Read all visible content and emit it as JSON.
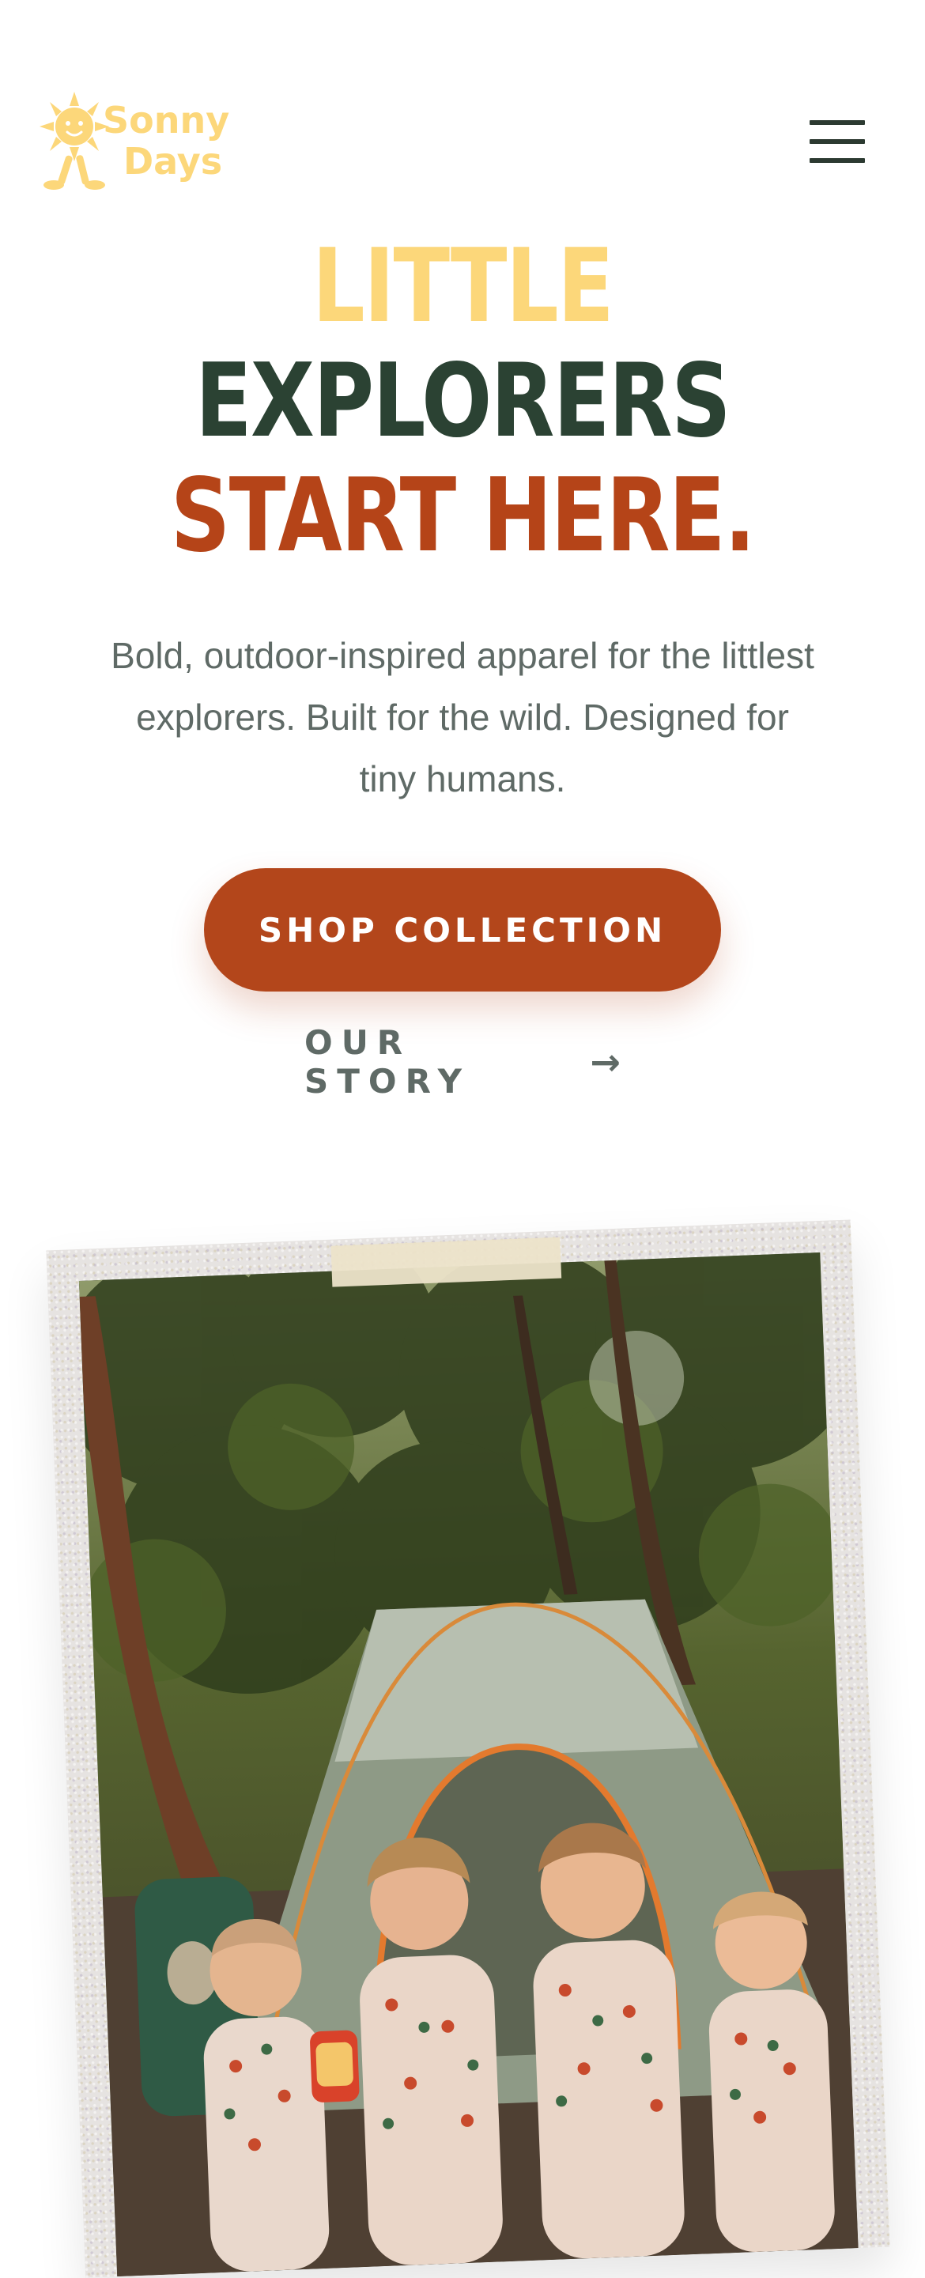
{
  "brand": {
    "logo_text_line1": "Sonny",
    "logo_text_line2": "Days",
    "logo_icon": "sun-mascot-icon",
    "color": "#fcd77a"
  },
  "header": {
    "menu_icon": "hamburger-menu-icon"
  },
  "hero": {
    "headline_line1": "LITTLE",
    "headline_line2": "EXPLORERS",
    "headline_line3": "START HERE.",
    "description": "Bold, outdoor-inspired apparel for the littlest explorers. Built for the wild. Designed for tiny humans.",
    "primary_cta": "SHOP COLLECTION",
    "secondary_cta": "OUR STORY",
    "secondary_cta_icon": "arrow-right-icon",
    "colors": {
      "line1": "#fcd77a",
      "line2": "#2b4233",
      "line3": "#b54418",
      "cta": "#b3461b"
    }
  },
  "photo": {
    "style": "tilted polaroid with tape",
    "icon": "family-camping-photo"
  }
}
